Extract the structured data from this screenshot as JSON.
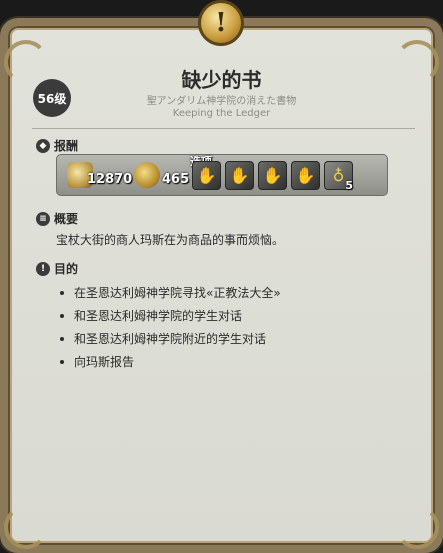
{
  "header": {
    "quest_icon": "exclamation-icon",
    "quest_symbol": "!",
    "level": "56级",
    "title": "缺少的书",
    "subtitle_jp": "聖アンダリム神学院の消えた書物",
    "subtitle_en": "Keeping the Ledger"
  },
  "rewards": {
    "heading": "报酬",
    "experience": "12870",
    "gil": "465",
    "optional_label": "选项",
    "items": [
      {
        "icon": "gauntlet-icon",
        "symbol": "✋"
      },
      {
        "icon": "gauntlet-icon",
        "symbol": "✋"
      },
      {
        "icon": "gauntlet-icon",
        "symbol": "✋"
      },
      {
        "icon": "gauntlet-icon",
        "symbol": "✋"
      }
    ],
    "potion": {
      "icon": "potion-icon",
      "symbol": "♁",
      "count": "5"
    }
  },
  "summary": {
    "heading": "概要",
    "text": "宝杖大街的商人玛斯在为商品的事而烦恼。"
  },
  "objectives": {
    "heading": "目的",
    "items": [
      "在圣恩达利姆神学院寻找«正教法大全»",
      "和圣恩达利姆神学院的学生对话",
      "和圣恩达利姆神学院附近的学生对话",
      "向玛斯报告"
    ]
  },
  "colors": {
    "panel_bg": "#dcddd5",
    "frame": "#8a7a5a",
    "gold": "#c79a3a"
  }
}
